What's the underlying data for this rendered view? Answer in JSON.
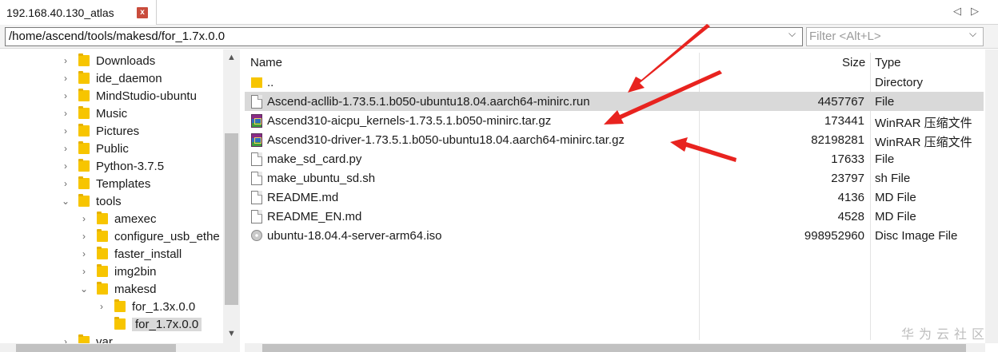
{
  "tab": {
    "title": "192.168.40.130_atlas",
    "close_glyph": "x",
    "nav_prev": "◁",
    "nav_next": "▷"
  },
  "path": {
    "value": "/home/ascend/tools/makesd/for_1.7x.0.0",
    "dropdown_glyph": "⌵"
  },
  "filter": {
    "placeholder": "Filter <Alt+L>",
    "dropdown_glyph": "⌵"
  },
  "tree": {
    "items": [
      {
        "label": "Downloads",
        "expanded": false
      },
      {
        "label": "ide_daemon",
        "expanded": false
      },
      {
        "label": "MindStudio-ubuntu",
        "expanded": false
      },
      {
        "label": "Music",
        "expanded": false
      },
      {
        "label": "Pictures",
        "expanded": false
      },
      {
        "label": "Public",
        "expanded": false
      },
      {
        "label": "Python-3.7.5",
        "expanded": false
      },
      {
        "label": "Templates",
        "expanded": false
      },
      {
        "label": "tools",
        "expanded": true
      },
      {
        "label": "amexec",
        "expanded": false
      },
      {
        "label": "configure_usb_ethe",
        "expanded": false
      },
      {
        "label": "faster_install",
        "expanded": false
      },
      {
        "label": "img2bin",
        "expanded": false
      },
      {
        "label": "makesd",
        "expanded": true
      },
      {
        "label": "for_1.3x.0.0",
        "expanded": false
      },
      {
        "label": "for_1.7x.0.0",
        "selected": true
      },
      {
        "label": "var",
        "expanded": false
      }
    ]
  },
  "list": {
    "headers": {
      "name": "Name",
      "size": "Size",
      "type": "Type"
    },
    "rows": [
      {
        "name": "..",
        "size": "",
        "type": "Directory",
        "icon": "folder-icon"
      },
      {
        "name": "Ascend-acllib-1.73.5.1.b050-ubuntu18.04.aarch64-minirc.run",
        "size": "4457767",
        "type": "File",
        "icon": "file-icon",
        "highlight": true
      },
      {
        "name": "Ascend310-aicpu_kernels-1.73.5.1.b050-minirc.tar.gz",
        "size": "173441",
        "type": "WinRAR 压缩文件",
        "icon": "winrar-icon"
      },
      {
        "name": "Ascend310-driver-1.73.5.1.b050-ubuntu18.04.aarch64-minirc.tar.gz",
        "size": "82198281",
        "type": "WinRAR 压缩文件",
        "icon": "winrar-icon"
      },
      {
        "name": "make_sd_card.py",
        "size": "17633",
        "type": "File",
        "icon": "file-icon"
      },
      {
        "name": "make_ubuntu_sd.sh",
        "size": "23797",
        "type": "sh File",
        "icon": "file-icon"
      },
      {
        "name": "README.md",
        "size": "4136",
        "type": "MD File",
        "icon": "file-icon"
      },
      {
        "name": "README_EN.md",
        "size": "4528",
        "type": "MD File",
        "icon": "file-icon"
      },
      {
        "name": "ubuntu-18.04.4-server-arm64.iso",
        "size": "998952960",
        "type": "Disc Image File",
        "icon": "disc-image-icon"
      }
    ]
  },
  "watermark": "华为云社区",
  "colors": {
    "annotation_arrow": "#e8231f",
    "folder": "#f7c500",
    "selection": "#d9d9d9",
    "tab_close": "#c94c3c"
  }
}
